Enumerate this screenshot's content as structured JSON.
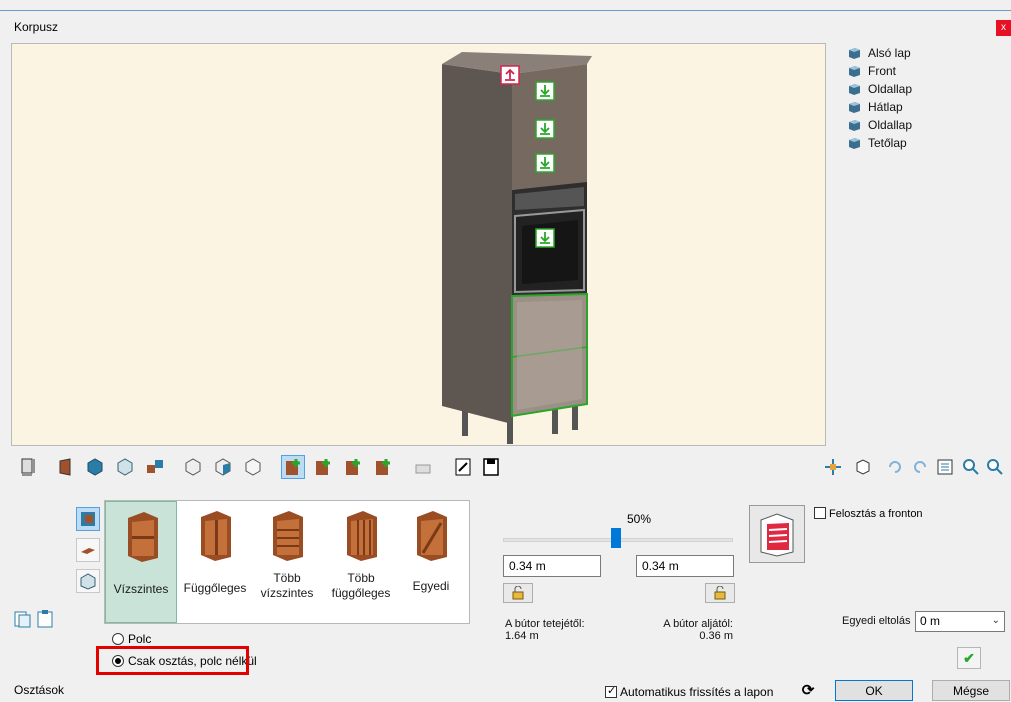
{
  "window": {
    "title": "Korpusz",
    "close_label": "x"
  },
  "tree": {
    "items": [
      {
        "label": "Alsó lap"
      },
      {
        "label": "Front"
      },
      {
        "label": "Oldallap"
      },
      {
        "label": "Hátlap"
      },
      {
        "label": "Oldallap"
      },
      {
        "label": "Tetőlap"
      }
    ]
  },
  "toolbar": {
    "left_icons": [
      "dimensions-icon",
      "door-icon",
      "box-blue-icon",
      "box-transparent-icon",
      "connect-icon",
      "panel-left-icon",
      "panel-front-icon",
      "panel-transparent-icon",
      "add-green-icon",
      "add-green-2-icon",
      "add-green-3-icon",
      "add-green-4-icon",
      "drawer-icon",
      "edit-icon",
      "save-icon"
    ],
    "right_icons": [
      "move-icon",
      "view-cube-icon",
      "undo-icon",
      "redo-icon",
      "properties-icon",
      "zoom-in-icon",
      "zoom-out-icon"
    ]
  },
  "division_tabs": [
    {
      "label_lines": [
        "Vízszintes"
      ],
      "active": true
    },
    {
      "label_lines": [
        "Függőleges"
      ],
      "active": false
    },
    {
      "label_lines": [
        "Több",
        "vízszintes"
      ],
      "active": false
    },
    {
      "label_lines": [
        "Több",
        "függőleges"
      ],
      "active": false
    },
    {
      "label_lines": [
        "Egyedi"
      ],
      "active": false
    }
  ],
  "options": {
    "polc_label": "Polc",
    "csak_label": "Csak osztás, polc nélkül",
    "selected": "csak"
  },
  "slider": {
    "percent_label": "50%",
    "value": 0.5
  },
  "inputs": {
    "left_value": "0.34 m",
    "right_value": "0.34 m"
  },
  "measurements": {
    "top_label": "A bútor tetejétől:",
    "top_value": "1.64 m",
    "bottom_label": "A bútor aljától:",
    "bottom_value": "0.36 m"
  },
  "front_split": {
    "label": "Felosztás a fronton",
    "checked": false
  },
  "offset": {
    "label": "Egyedi eltolás",
    "value": "0 m"
  },
  "status": {
    "section": "Osztások",
    "auto_refresh_label": "Automatikus frissítés a lapon",
    "auto_refresh_checked": true
  },
  "buttons": {
    "ok": "OK",
    "cancel": "Mégse"
  },
  "colors": {
    "viewport_bg": "#fbf4e2",
    "accent": "#0078d7",
    "highlight": "#e30000",
    "cabinet": "#6b625b",
    "oven": "#3a3a3a",
    "selection_green": "#2aa72a"
  }
}
